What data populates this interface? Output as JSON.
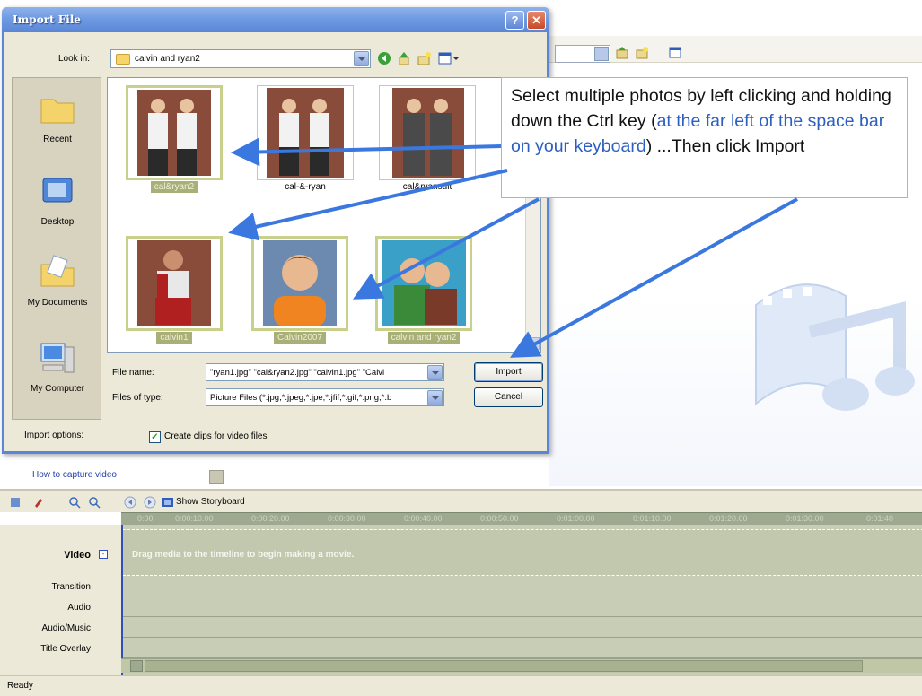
{
  "dialog": {
    "title": "Import File",
    "look_in_label": "Look in:",
    "look_in_value": "calvin and ryan2",
    "places": [
      "Recent",
      "Desktop",
      "My Documents",
      "My Computer"
    ],
    "files": [
      {
        "name": "cal&ryan2",
        "selected": true
      },
      {
        "name": "cal-&-ryan",
        "selected": false
      },
      {
        "name": "cal&ryansuit",
        "selected": false
      },
      {
        "name": "calvin1",
        "selected": true
      },
      {
        "name": "Calvin2007",
        "selected": true
      },
      {
        "name": "calvin and ryan2",
        "selected": true
      }
    ],
    "file_name_label": "File name:",
    "file_name_value": "\"ryan1.jpg\" \"cal&ryan2.jpg\" \"calvin1.jpg\" \"Calvi",
    "file_type_label": "Files of type:",
    "file_type_value": "Picture Files (*.jpg,*.jpeg,*.jpe,*.jfif,*.gif,*.png,*.b",
    "import_button": "Import",
    "cancel_button": "Cancel",
    "import_options_label": "Import options:",
    "create_clips_label": "Create clips for video files",
    "create_clips_checked": true
  },
  "callout": {
    "part1": "Select multiple photos by left clicking and holding down the Ctrl  key (",
    "highlight": "at the far left of the space bar on your keyboard",
    "part2": ")  ...Then click Import"
  },
  "tasks": {
    "capture_link": "How to capture video"
  },
  "timeline": {
    "show_storyboard": "Show Storyboard",
    "ruler_ticks": [
      "0:00",
      "0:00:10.00",
      "0:00:20.00",
      "0:00:30.00",
      "0:00:40.00",
      "0:00:50.00",
      "0:01:00.00",
      "0:01:10.00",
      "0:01:20.00",
      "0:01:30.00",
      "0:01:40"
    ],
    "tracks": [
      "Video",
      "Transition",
      "Audio",
      "Audio/Music",
      "Title Overlay"
    ],
    "video_hint": "Drag media to the timeline to begin making a movie."
  },
  "status": {
    "text": "Ready"
  },
  "colors": {
    "title_bar": "#6f9be3",
    "arrow": "#3a78e0",
    "timeline_track": "#c8cdb6",
    "highlight_text": "#2c5fc0"
  }
}
